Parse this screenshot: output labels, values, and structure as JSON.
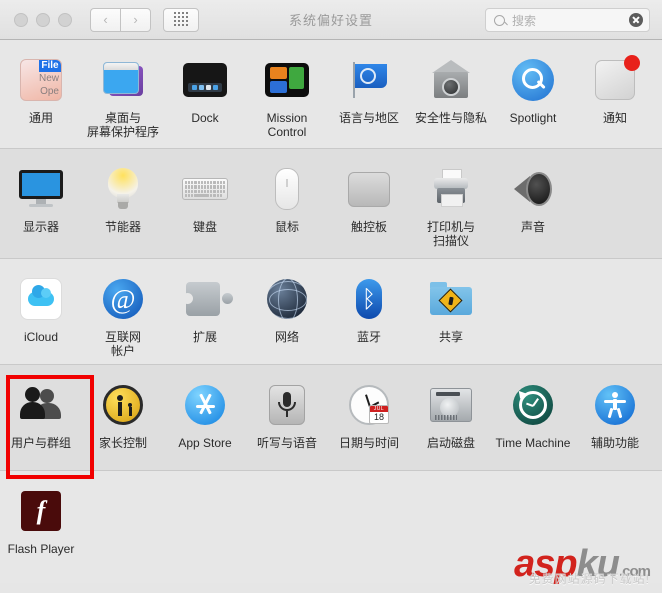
{
  "window": {
    "title": "系统偏好设置"
  },
  "toolbar": {
    "back_label": "‹",
    "forward_label": "›",
    "grid_label": "",
    "search_placeholder": "搜索",
    "search_value": ""
  },
  "rows": [
    {
      "items": [
        {
          "label": "通用",
          "icon": "general-icon",
          "tiles": {
            "file": "File",
            "new": "New",
            "open": "Ope"
          }
        },
        {
          "label": "桌面与\n屏幕保护程序",
          "icon": "desktop-screensaver-icon"
        },
        {
          "label": "Dock",
          "icon": "dock-icon"
        },
        {
          "label": "Mission\nControl",
          "icon": "mission-control-icon"
        },
        {
          "label": "语言与地区",
          "icon": "language-region-icon"
        },
        {
          "label": "安全性与隐私",
          "icon": "security-privacy-icon"
        },
        {
          "label": "Spotlight",
          "icon": "spotlight-icon"
        },
        {
          "label": "通知",
          "icon": "notifications-icon"
        }
      ]
    },
    {
      "items": [
        {
          "label": "显示器",
          "icon": "displays-icon"
        },
        {
          "label": "节能器",
          "icon": "energy-saver-icon"
        },
        {
          "label": "键盘",
          "icon": "keyboard-icon"
        },
        {
          "label": "鼠标",
          "icon": "mouse-icon"
        },
        {
          "label": "触控板",
          "icon": "trackpad-icon"
        },
        {
          "label": "打印机与\n扫描仪",
          "icon": "printers-scanners-icon"
        },
        {
          "label": "声音",
          "icon": "sound-icon"
        }
      ]
    },
    {
      "items": [
        {
          "label": "iCloud",
          "icon": "icloud-icon"
        },
        {
          "label": "互联网\n帐户",
          "icon": "internet-accounts-icon",
          "glyph": "@"
        },
        {
          "label": "扩展",
          "icon": "extensions-icon"
        },
        {
          "label": "网络",
          "icon": "network-icon"
        },
        {
          "label": "蓝牙",
          "icon": "bluetooth-icon",
          "glyph": "ᛒ"
        },
        {
          "label": "共享",
          "icon": "sharing-icon"
        }
      ]
    },
    {
      "items": [
        {
          "label": "用户与群组",
          "icon": "users-groups-icon",
          "selected": true
        },
        {
          "label": "家长控制",
          "icon": "parental-controls-icon"
        },
        {
          "label": "App Store",
          "icon": "app-store-icon"
        },
        {
          "label": "听写与语音",
          "icon": "dictation-speech-icon"
        },
        {
          "label": "日期与时间",
          "icon": "date-time-icon",
          "clock": {
            "month": "JUL",
            "day": "18"
          }
        },
        {
          "label": "启动磁盘",
          "icon": "startup-disk-icon"
        },
        {
          "label": "Time Machine",
          "icon": "time-machine-icon"
        },
        {
          "label": "辅助功能",
          "icon": "accessibility-icon"
        }
      ]
    },
    {
      "items": [
        {
          "label": "Flash Player",
          "icon": "flash-player-icon",
          "glyph": "f"
        }
      ]
    }
  ],
  "highlight": {
    "target_label": "用户与群组",
    "color": "#f10000"
  },
  "watermark": {
    "asp": "asp",
    "ku": "ku",
    "com": ".com",
    "sub": "免费网站源码下载站!"
  }
}
